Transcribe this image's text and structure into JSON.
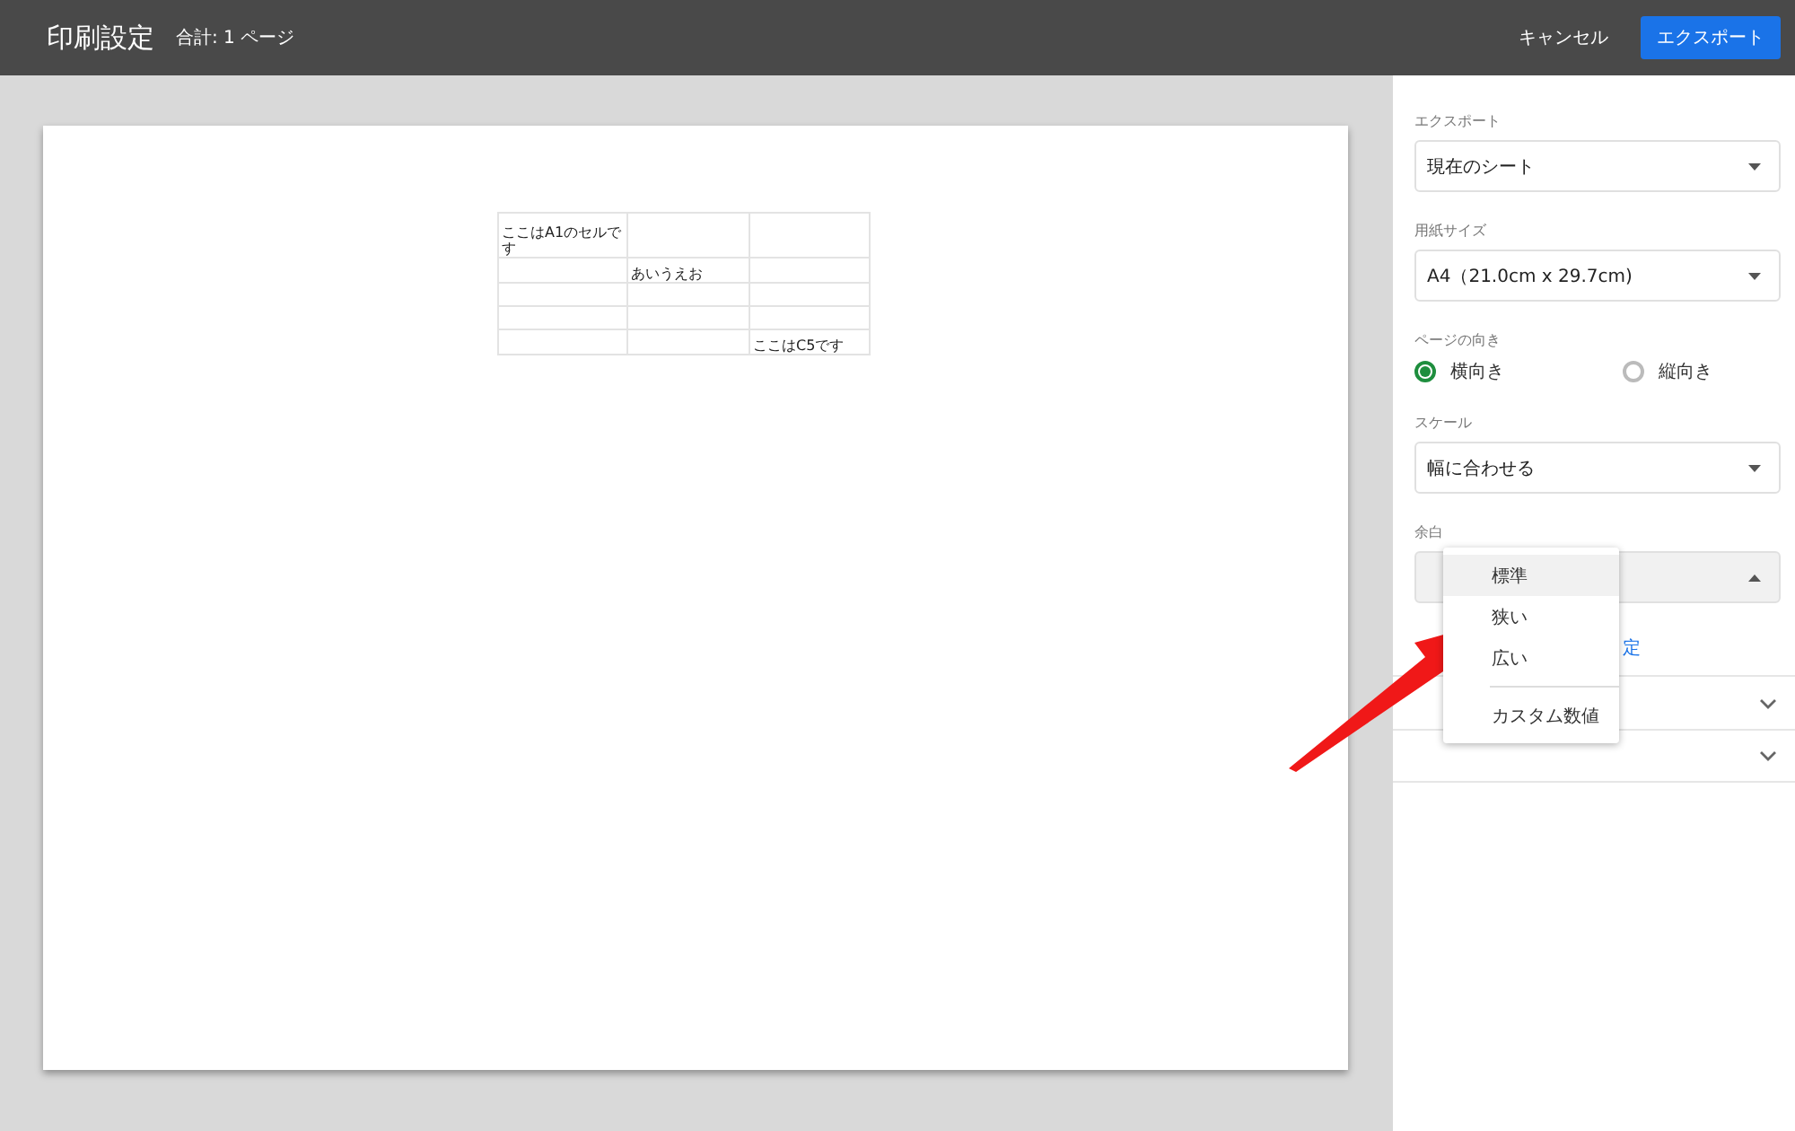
{
  "header": {
    "title": "印刷設定",
    "total": "合計: 1 ページ",
    "cancel": "キャンセル",
    "export": "エクスポート"
  },
  "sheet": {
    "rows": [
      [
        "ここはA1のセルです",
        "",
        ""
      ],
      [
        "",
        "あいうえお",
        ""
      ],
      [
        "",
        "",
        ""
      ],
      [
        "",
        "",
        ""
      ],
      [
        "",
        "",
        "ここはC5です"
      ]
    ]
  },
  "panel": {
    "export": {
      "label": "エクスポート",
      "value": "現在のシート"
    },
    "paper": {
      "label": "用紙サイズ",
      "value": "A4（21.0cm x 29.7cm)"
    },
    "orientation": {
      "label": "ページの向き",
      "options": [
        {
          "label": "横向き",
          "selected": true
        },
        {
          "label": "縦向き",
          "selected": false
        }
      ]
    },
    "scale": {
      "label": "スケール",
      "value": "幅に合わせる"
    },
    "margin": {
      "label": "余白",
      "expanded": true,
      "link": "定",
      "menu": [
        {
          "label": "標準",
          "selected": true
        },
        {
          "label": "狭い",
          "selected": false
        },
        {
          "label": "広い",
          "selected": false
        },
        {
          "label": "カスタム数値",
          "selected": false
        }
      ]
    },
    "sections": [
      {
        "expanded": false
      },
      {
        "expanded": false
      }
    ]
  }
}
